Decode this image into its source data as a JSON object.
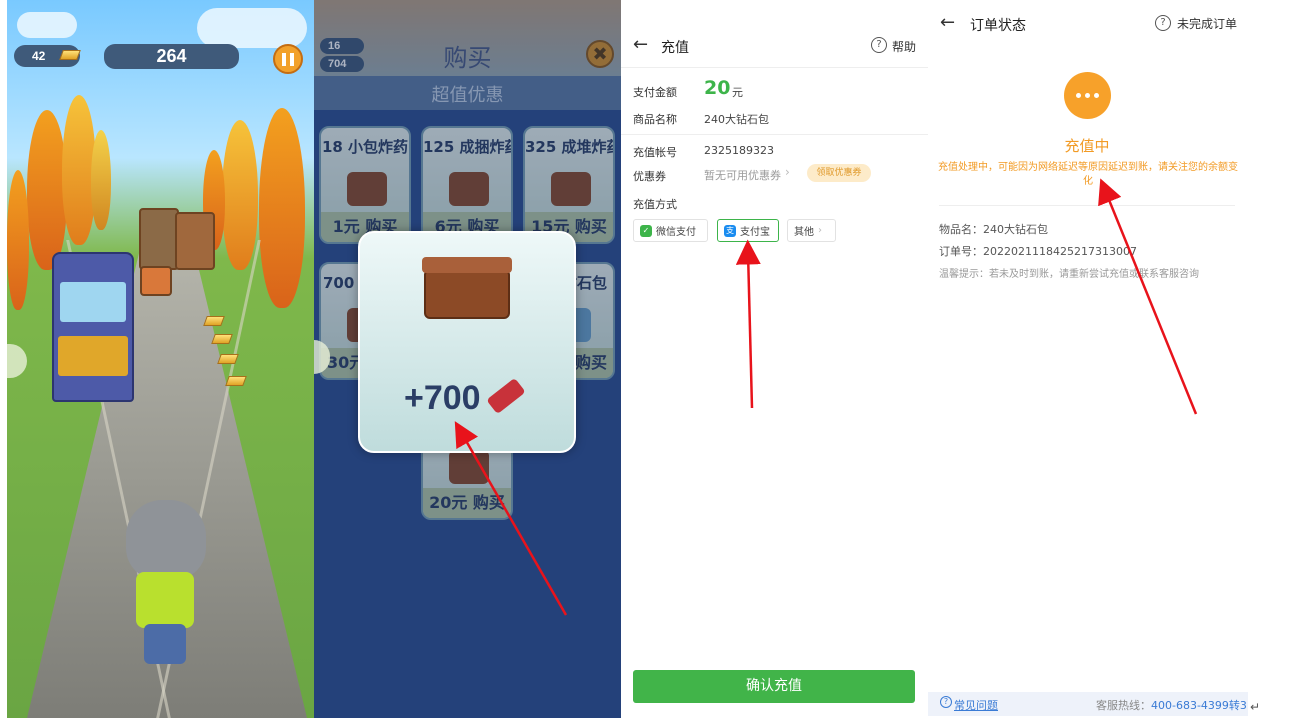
{
  "game": {
    "gold_count": "42",
    "score": "264"
  },
  "shop": {
    "counter_gold": "16",
    "counter_dynamite": "704",
    "title": "购买",
    "subtitle": "超值优惠",
    "close_label": "✖",
    "items": [
      {
        "name": "18 小包炸药",
        "price": "1元 购买"
      },
      {
        "name": "125 成捆炸药",
        "price": "6元 购买"
      },
      {
        "name": "325 成堆炸药",
        "price": "15元 购买"
      },
      {
        "name": "700 盒",
        "price": "30元"
      },
      {
        "name": "钻石包",
        "price": "购买"
      },
      {
        "name": "",
        "price": "20元 购买"
      }
    ],
    "reward_amount": "+700"
  },
  "recharge": {
    "title": "充值",
    "help_label": "帮助",
    "help_icon": "?",
    "amount_label": "支付金额",
    "amount_value": "20",
    "amount_unit": "元",
    "product_label": "商品名称",
    "product_value": "240大钻石包",
    "account_label": "充值帐号",
    "account_value": "2325189323",
    "coupon_label": "优惠券",
    "coupon_hint": "暂无可用优惠券",
    "coupon_button": "领取优惠券",
    "method_label": "充值方式",
    "methods": [
      {
        "label": "微信支付",
        "icon": "wechat-pay-icon",
        "selected": false
      },
      {
        "label": "支付宝",
        "icon": "alipay-icon",
        "selected": true
      },
      {
        "label": "其他",
        "icon": "chevron-right-icon",
        "selected": false
      }
    ],
    "confirm_label": "确认充值"
  },
  "order": {
    "title": "订单状态",
    "unfinished_label": "未完成订单",
    "status_title": "充值中",
    "status_desc": "充值处理中，可能因为网络延迟等原因延迟到账，请关注您的余额变化",
    "item_name": "物品名：240大钻石包",
    "order_no": "订单号：20220211184252173130​07",
    "tip": "温馨提示：若未及时到账，请重新尝试充值或联系客服咨询",
    "faq_label": "常见问题",
    "hotline_label": "客服热线：",
    "hotline_number": "400-683-4399转3"
  },
  "colors": {
    "accent_green": "#41b449",
    "status_orange": "#f29b25",
    "arrow_red": "#e8131b"
  }
}
